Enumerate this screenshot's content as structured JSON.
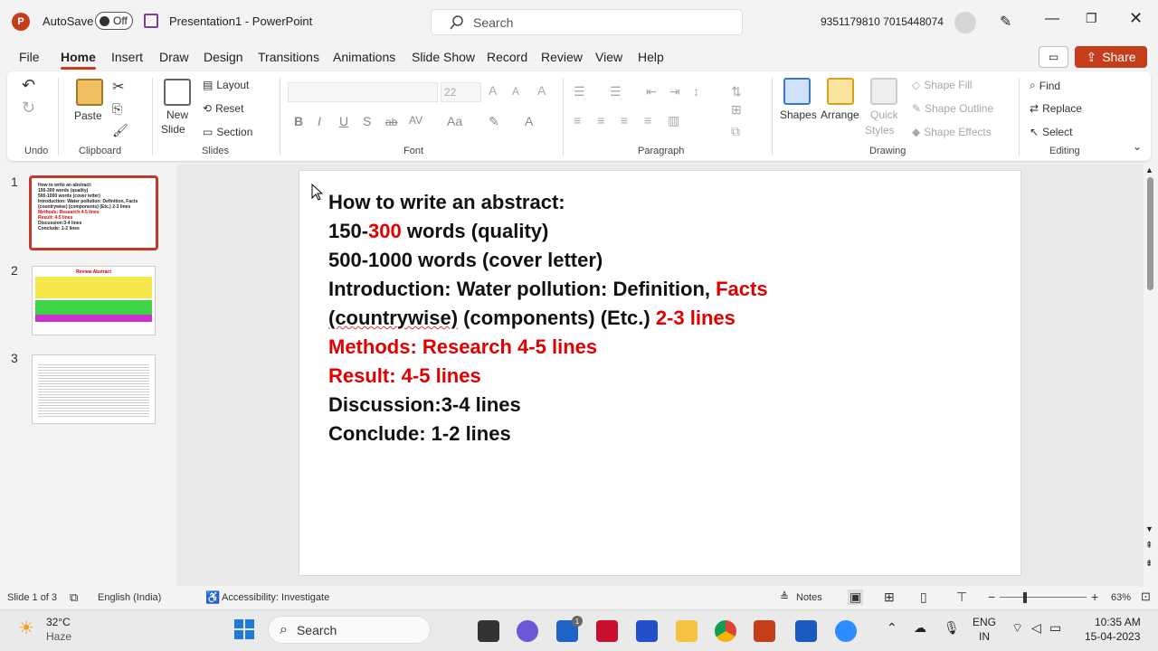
{
  "app": {
    "autosave_label": "AutoSave",
    "autosave_state": "Off",
    "doc_title": "Presentation1",
    "app_name": "PowerPoint",
    "title_sep": " - ",
    "search_placeholder": "Search",
    "account": "9351179810 7015448074"
  },
  "tabs": [
    "File",
    "Home",
    "Insert",
    "Draw",
    "Design",
    "Transitions",
    "Animations",
    "Slide Show",
    "Record",
    "Review",
    "View",
    "Help"
  ],
  "share_label": "Share",
  "ribbon": {
    "undo": {
      "label": "Undo"
    },
    "clipboard": {
      "label": "Clipboard",
      "paste": "Paste"
    },
    "slides": {
      "label": "Slides",
      "new_slide_1": "New",
      "new_slide_2": "Slide",
      "layout": "Layout",
      "reset": "Reset",
      "section": "Section"
    },
    "font": {
      "label": "Font",
      "size": "22"
    },
    "paragraph": {
      "label": "Paragraph"
    },
    "drawing": {
      "label": "Drawing",
      "shapes": "Shapes",
      "arrange": "Arrange",
      "quick_styles_1": "Quick",
      "quick_styles_2": "Styles",
      "shape_fill": "Shape Fill",
      "shape_outline": "Shape Outline",
      "shape_effects": "Shape Effects"
    },
    "editing": {
      "label": "Editing",
      "find": "Find",
      "replace": "Replace",
      "select": "Select"
    }
  },
  "thumbnails": [
    {
      "num": "1",
      "lines": [
        "How to write an abstract:",
        "150-300 words (quality)",
        "500-1000 words (cover letter)",
        "Introduction: Water pollution: Definition, Facts",
        "(countrywise) (components) (Etc.) 2-3 lines",
        "Methods: Research 4-5 lines",
        "Result: 4-5 lines",
        "Discussion:3-4 lines",
        "Conclude: 1-2 lines"
      ]
    },
    {
      "num": "2",
      "title": "Review Abstract"
    },
    {
      "num": "3"
    }
  ],
  "slide": {
    "line1": "How to write an abstract:",
    "line2a": "150-",
    "line2b": "300",
    "line2c": " words (quality)",
    "line3": "500-1000 words (cover letter)",
    "line4a": "Introduction: Water pollution: Definition, ",
    "line4b": "Facts",
    "line5a": "(countrywise)",
    "line5b": " (components) (Etc.) ",
    "line5c": "2-3 lines",
    "line6": "Methods: Research 4-5 lines",
    "line7": "Result:  4-5 lines",
    "line8": "Discussion:3-4 lines",
    "line9": "Conclude: 1-2 lines"
  },
  "status": {
    "slide_of": "Slide 1 of 3",
    "language": "English (India)",
    "accessibility": "Accessibility: Investigate",
    "notes": "Notes",
    "zoom": "63%"
  },
  "taskbar": {
    "temp": "32°C",
    "weather": "Haze",
    "search": "Search",
    "lang1": "ENG",
    "lang2": "IN",
    "time": "10:35 AM",
    "date": "15-04-2023",
    "badge": "1"
  },
  "colors": {
    "accent": "#c43e1c",
    "highlight_red": "#e00000"
  }
}
